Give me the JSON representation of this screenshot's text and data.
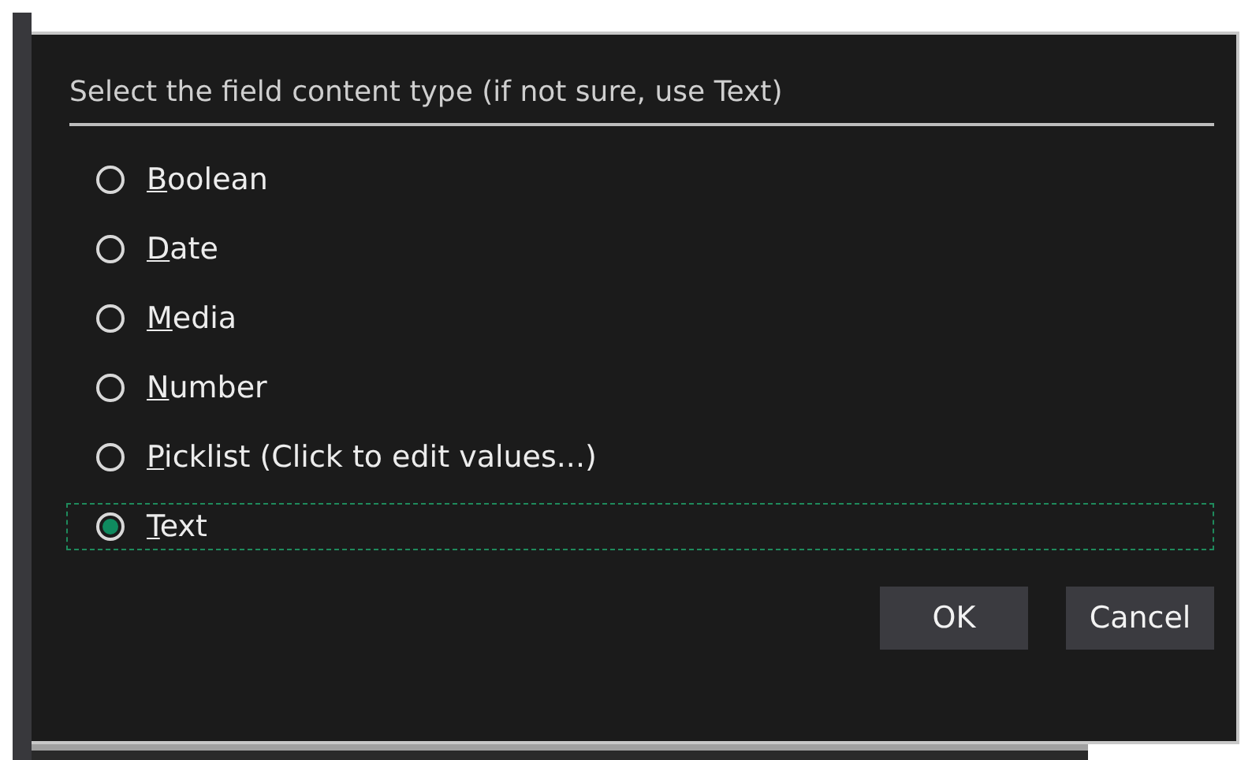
{
  "dialog": {
    "prompt": "Select the field content type (if not sure, use Text)",
    "options": [
      {
        "label": "Boolean",
        "selected": false
      },
      {
        "label": "Date",
        "selected": false
      },
      {
        "label": "Media",
        "selected": false
      },
      {
        "label": "Number",
        "selected": false
      },
      {
        "label": "Picklist (Click to edit values...)",
        "selected": false
      },
      {
        "label": "Text",
        "selected": true
      }
    ],
    "buttons": [
      "OK",
      "Cancel"
    ]
  }
}
